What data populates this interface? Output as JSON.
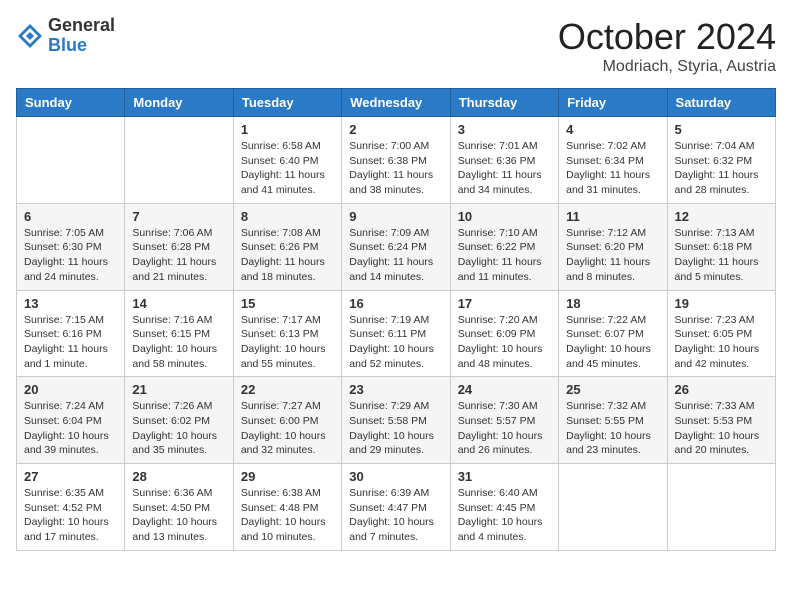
{
  "header": {
    "logo_general": "General",
    "logo_blue": "Blue",
    "month_title": "October 2024",
    "location": "Modriach, Styria, Austria"
  },
  "weekdays": [
    "Sunday",
    "Monday",
    "Tuesday",
    "Wednesday",
    "Thursday",
    "Friday",
    "Saturday"
  ],
  "weeks": [
    [
      {
        "day": "",
        "info": ""
      },
      {
        "day": "",
        "info": ""
      },
      {
        "day": "1",
        "sunrise": "6:58 AM",
        "sunset": "6:40 PM",
        "daylight": "11 hours and 41 minutes."
      },
      {
        "day": "2",
        "sunrise": "7:00 AM",
        "sunset": "6:38 PM",
        "daylight": "11 hours and 38 minutes."
      },
      {
        "day": "3",
        "sunrise": "7:01 AM",
        "sunset": "6:36 PM",
        "daylight": "11 hours and 34 minutes."
      },
      {
        "day": "4",
        "sunrise": "7:02 AM",
        "sunset": "6:34 PM",
        "daylight": "11 hours and 31 minutes."
      },
      {
        "day": "5",
        "sunrise": "7:04 AM",
        "sunset": "6:32 PM",
        "daylight": "11 hours and 28 minutes."
      }
    ],
    [
      {
        "day": "6",
        "sunrise": "7:05 AM",
        "sunset": "6:30 PM",
        "daylight": "11 hours and 24 minutes."
      },
      {
        "day": "7",
        "sunrise": "7:06 AM",
        "sunset": "6:28 PM",
        "daylight": "11 hours and 21 minutes."
      },
      {
        "day": "8",
        "sunrise": "7:08 AM",
        "sunset": "6:26 PM",
        "daylight": "11 hours and 18 minutes."
      },
      {
        "day": "9",
        "sunrise": "7:09 AM",
        "sunset": "6:24 PM",
        "daylight": "11 hours and 14 minutes."
      },
      {
        "day": "10",
        "sunrise": "7:10 AM",
        "sunset": "6:22 PM",
        "daylight": "11 hours and 11 minutes."
      },
      {
        "day": "11",
        "sunrise": "7:12 AM",
        "sunset": "6:20 PM",
        "daylight": "11 hours and 8 minutes."
      },
      {
        "day": "12",
        "sunrise": "7:13 AM",
        "sunset": "6:18 PM",
        "daylight": "11 hours and 5 minutes."
      }
    ],
    [
      {
        "day": "13",
        "sunrise": "7:15 AM",
        "sunset": "6:16 PM",
        "daylight": "11 hours and 1 minute."
      },
      {
        "day": "14",
        "sunrise": "7:16 AM",
        "sunset": "6:15 PM",
        "daylight": "10 hours and 58 minutes."
      },
      {
        "day": "15",
        "sunrise": "7:17 AM",
        "sunset": "6:13 PM",
        "daylight": "10 hours and 55 minutes."
      },
      {
        "day": "16",
        "sunrise": "7:19 AM",
        "sunset": "6:11 PM",
        "daylight": "10 hours and 52 minutes."
      },
      {
        "day": "17",
        "sunrise": "7:20 AM",
        "sunset": "6:09 PM",
        "daylight": "10 hours and 48 minutes."
      },
      {
        "day": "18",
        "sunrise": "7:22 AM",
        "sunset": "6:07 PM",
        "daylight": "10 hours and 45 minutes."
      },
      {
        "day": "19",
        "sunrise": "7:23 AM",
        "sunset": "6:05 PM",
        "daylight": "10 hours and 42 minutes."
      }
    ],
    [
      {
        "day": "20",
        "sunrise": "7:24 AM",
        "sunset": "6:04 PM",
        "daylight": "10 hours and 39 minutes."
      },
      {
        "day": "21",
        "sunrise": "7:26 AM",
        "sunset": "6:02 PM",
        "daylight": "10 hours and 35 minutes."
      },
      {
        "day": "22",
        "sunrise": "7:27 AM",
        "sunset": "6:00 PM",
        "daylight": "10 hours and 32 minutes."
      },
      {
        "day": "23",
        "sunrise": "7:29 AM",
        "sunset": "5:58 PM",
        "daylight": "10 hours and 29 minutes."
      },
      {
        "day": "24",
        "sunrise": "7:30 AM",
        "sunset": "5:57 PM",
        "daylight": "10 hours and 26 minutes."
      },
      {
        "day": "25",
        "sunrise": "7:32 AM",
        "sunset": "5:55 PM",
        "daylight": "10 hours and 23 minutes."
      },
      {
        "day": "26",
        "sunrise": "7:33 AM",
        "sunset": "5:53 PM",
        "daylight": "10 hours and 20 minutes."
      }
    ],
    [
      {
        "day": "27",
        "sunrise": "6:35 AM",
        "sunset": "4:52 PM",
        "daylight": "10 hours and 17 minutes."
      },
      {
        "day": "28",
        "sunrise": "6:36 AM",
        "sunset": "4:50 PM",
        "daylight": "10 hours and 13 minutes."
      },
      {
        "day": "29",
        "sunrise": "6:38 AM",
        "sunset": "4:48 PM",
        "daylight": "10 hours and 10 minutes."
      },
      {
        "day": "30",
        "sunrise": "6:39 AM",
        "sunset": "4:47 PM",
        "daylight": "10 hours and 7 minutes."
      },
      {
        "day": "31",
        "sunrise": "6:40 AM",
        "sunset": "4:45 PM",
        "daylight": "10 hours and 4 minutes."
      },
      {
        "day": "",
        "info": ""
      },
      {
        "day": "",
        "info": ""
      }
    ]
  ]
}
